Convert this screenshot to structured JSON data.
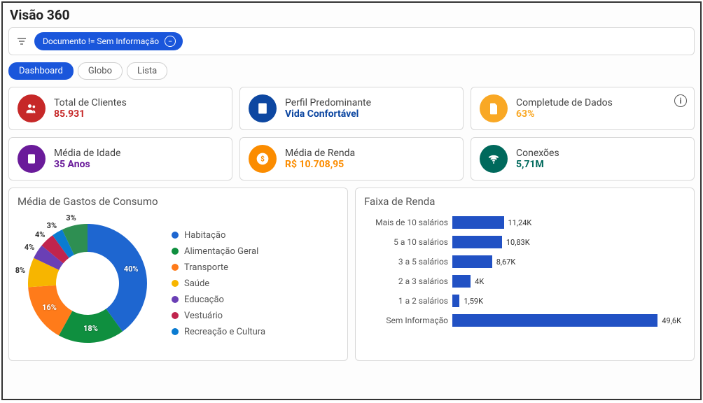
{
  "title": "Visão 360",
  "filter": {
    "label": "Documento != Sem Informação"
  },
  "tabs": [
    {
      "label": "Dashboard",
      "active": true
    },
    {
      "label": "Globo",
      "active": false
    },
    {
      "label": "Lista",
      "active": false
    }
  ],
  "metrics_row1": [
    {
      "label": "Total de Clientes",
      "value": "85.931",
      "color": "#c62828",
      "icon": "users-icon"
    },
    {
      "label": "Perfil Predominante",
      "value": "Vida Confortável",
      "color": "#0d47a1",
      "icon": "book-icon"
    },
    {
      "label": "Completude de Dados",
      "value": "63%",
      "color": "#f9a825",
      "icon": "file-icon",
      "info": true
    }
  ],
  "metrics_row2": [
    {
      "label": "Média de Idade",
      "value": "35 Anos",
      "color": "#6a1b9a",
      "icon": "person-icon"
    },
    {
      "label": "Média de Renda",
      "value": "R$ 10.708,95",
      "color": "#fb8c00",
      "icon": "dollar-icon"
    },
    {
      "label": "Conexões",
      "value": "5,71M",
      "color": "#00695c",
      "icon": "wifi-icon"
    }
  ],
  "chart_data": [
    {
      "type": "pie",
      "title": "Média de Gastos de Consumo",
      "series": [
        {
          "name": "Habitação",
          "value": 40,
          "color": "#1e66d0"
        },
        {
          "name": "Alimentação Geral",
          "value": 18,
          "color": "#0f8f3f"
        },
        {
          "name": "Transporte",
          "value": 16,
          "color": "#ff7b1a"
        },
        {
          "name": "Saúde",
          "value": 8,
          "color": "#f7b500"
        },
        {
          "name": "Educação",
          "value": 4,
          "color": "#6a3fb5"
        },
        {
          "name": "Vestuário",
          "value": 4,
          "color": "#c0244d"
        },
        {
          "name": "Recreação e Cultura",
          "value": 3,
          "color": "#0a7bd1"
        }
      ],
      "remainder_value": 7,
      "remainder_color": "#2e8f52",
      "labels": [
        "40%",
        "18%",
        "16%",
        "8%",
        "4%",
        "4%",
        "3%",
        "3%"
      ]
    },
    {
      "type": "bar",
      "title": "Faixa de Renda",
      "orientation": "horizontal",
      "xlim": [
        0,
        50
      ],
      "categories": [
        "Mais de 10 salários",
        "5 a 10 salários",
        "3 a 5 salários",
        "2 a 3 salários",
        "1 a 2 salários",
        "Sem Informação"
      ],
      "values": [
        11.24,
        10.83,
        8.67,
        4,
        1.59,
        49.6
      ],
      "value_labels": [
        "11,24K",
        "10,83K",
        "8,67K",
        "4K",
        "1,59K",
        "49,6K"
      ],
      "color": "#2151c4"
    }
  ]
}
